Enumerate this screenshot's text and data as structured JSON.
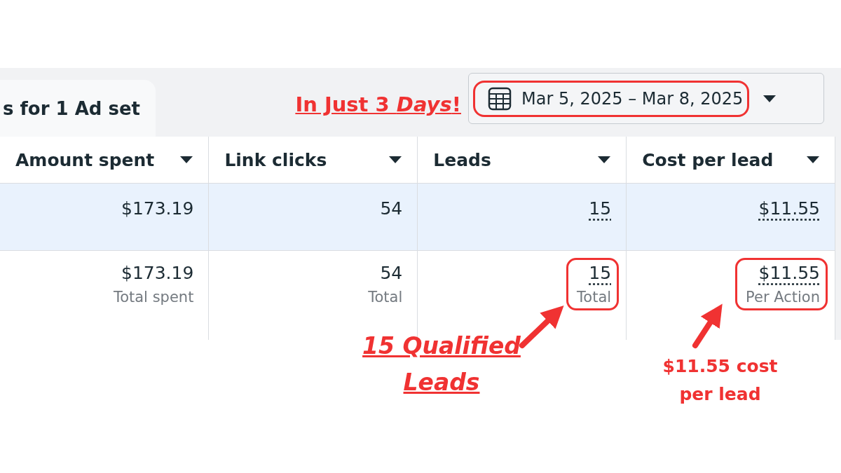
{
  "tab": {
    "label": "s for 1 Ad set"
  },
  "headline": "In Just 3 *Days*!",
  "date_range": {
    "label": "Mar 5, 2025 – Mar 8, 2025",
    "circled": true
  },
  "table": {
    "columns": [
      "Amount spent",
      "Link clicks",
      "Leads",
      "Cost per lead"
    ],
    "rows": [
      {
        "kind": "item",
        "cells": [
          {
            "value": "$173.19",
            "underlined": false,
            "circled": false
          },
          {
            "value": "54",
            "underlined": false,
            "circled": false
          },
          {
            "value": "15",
            "underlined": true,
            "circled": false
          },
          {
            "value": "$11.55",
            "underlined": true,
            "circled": false
          }
        ]
      },
      {
        "kind": "total",
        "cells": [
          {
            "value": "$173.19",
            "caption": "Total spent",
            "underlined": false,
            "circled": false
          },
          {
            "value": "54",
            "caption": "Total",
            "underlined": false,
            "circled": false
          },
          {
            "value": "15",
            "caption": "Total",
            "underlined": true,
            "circled": true
          },
          {
            "value": "$11.55",
            "caption": "Per Action",
            "underlined": true,
            "circled": true
          }
        ]
      }
    ]
  },
  "notes": [
    {
      "kind": "emphasis",
      "text": "15 Qualified Leads"
    },
    {
      "kind": "plain",
      "text": "$11.55 cost per lead"
    }
  ]
}
